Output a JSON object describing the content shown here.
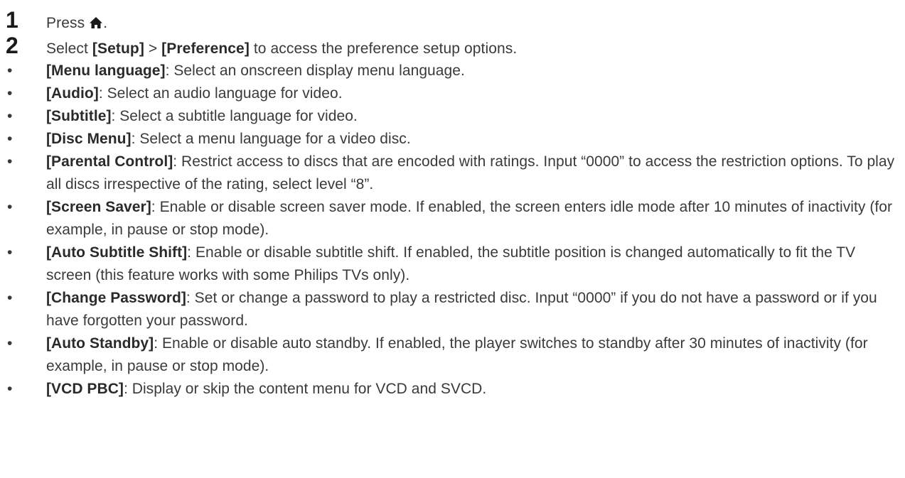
{
  "steps": [
    {
      "num": "1",
      "text": "Press",
      "icon": "home-icon",
      "after": "."
    },
    {
      "num": "2",
      "text_before": "Select ",
      "item1": "[Setup]",
      "sep": " > ",
      "item2": "[Preference]",
      "text_after": " to access the preference setup options."
    }
  ],
  "bullet_symbol": "•",
  "bullets": [
    {
      "term": "[Menu language]",
      "desc": ": Select an onscreen display menu language."
    },
    {
      "term": "[Audio]",
      "desc": ": Select an audio language for video."
    },
    {
      "term": "[Subtitle]",
      "desc": ": Select a subtitle language for video."
    },
    {
      "term": "[Disc Menu]",
      "desc": ": Select a menu language for a video disc."
    },
    {
      "term": "[Parental Control]",
      "desc": ": Restrict access to discs that are encoded with ratings. Input “0000” to access the restriction options. To play all discs irrespective of the rating, select level “8”."
    },
    {
      "term": "[Screen Saver]",
      "desc": ": Enable or disable screen saver mode. If enabled, the screen enters idle mode after 10 minutes of inactivity (for example, in pause or stop mode)."
    },
    {
      "term": "[Auto Subtitle Shift]",
      "desc": ": Enable or disable subtitle shift. If enabled, the subtitle position is changed automatically to fit the TV screen (this feature works with some Philips TVs only)."
    },
    {
      "term": "[Change Password]",
      "desc": ": Set or change a password to play a restricted disc. Input “0000” if you do not have a password or if you have forgotten your password."
    },
    {
      "term": "[Auto Standby]",
      "desc": ": Enable or disable auto standby. If enabled, the player switches to standby after 30 minutes of inactivity (for example, in pause or stop mode)."
    },
    {
      "term": "[VCD PBC]",
      "desc": ": Display or skip the content menu for VCD and SVCD."
    }
  ]
}
